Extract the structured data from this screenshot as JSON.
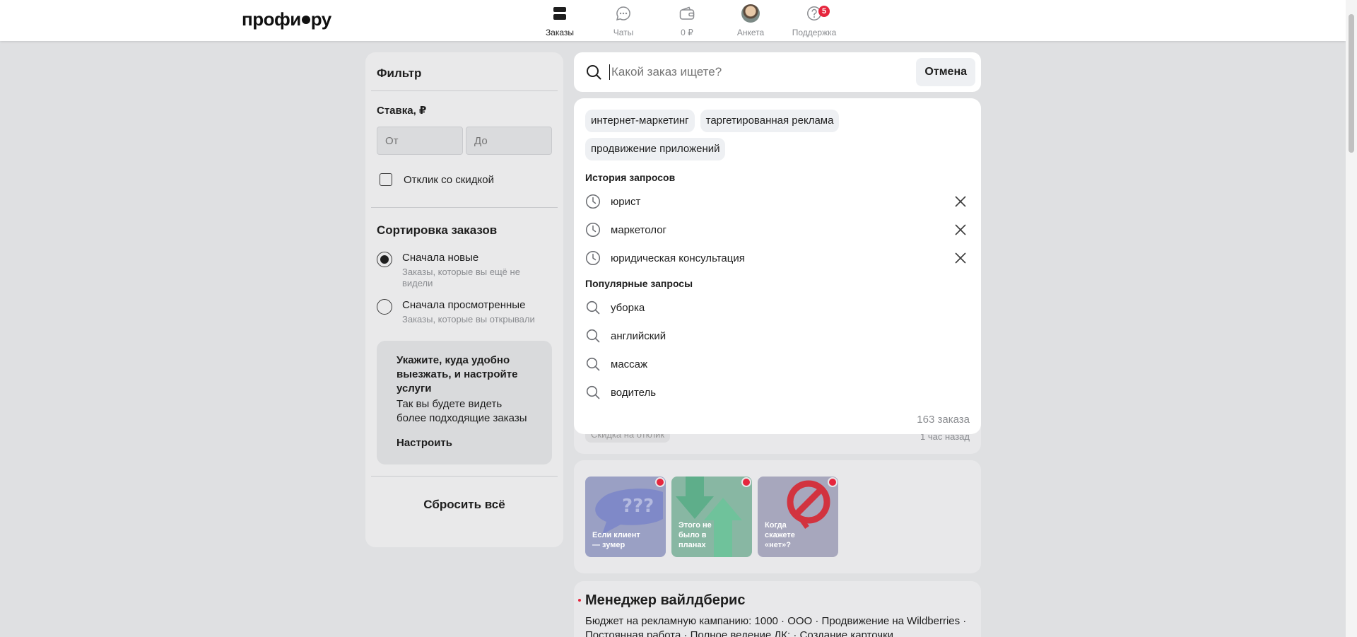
{
  "header": {
    "logo": "профи",
    "logo_suffix": "ру",
    "nav": [
      {
        "label": "Заказы",
        "icon": "orders-icon",
        "active": true
      },
      {
        "label": "Чаты",
        "icon": "chat-icon"
      },
      {
        "label": "0 ₽",
        "icon": "wallet-icon"
      },
      {
        "label": "Анкета",
        "icon": "avatar"
      },
      {
        "label": "Поддержка",
        "icon": "help-icon",
        "badge": "5"
      }
    ]
  },
  "filter": {
    "title": "Фильтр",
    "rate_label": "Ставка, ₽",
    "from_placeholder": "От",
    "to_placeholder": "До",
    "discount_label": "Отклик со скидкой",
    "sort_title": "Сортировка заказов",
    "sort_options": [
      {
        "label": "Сначала новые",
        "desc": "Заказы, которые вы ещё не видели",
        "checked": true
      },
      {
        "label": "Сначала просмотренные",
        "desc": "Заказы, которые вы открывали",
        "checked": false
      }
    ],
    "promo": {
      "title": "Укажите, куда удобно выезжать, и настройте услуги",
      "text": "Так вы будете видеть более подходящие заказы",
      "link": "Настроить"
    },
    "reset": "Сбросить всё"
  },
  "search": {
    "placeholder": "Какой заказ ищете?",
    "cancel": "Отмена",
    "tags": [
      "интернет-маркетинг",
      "таргетированная реклама",
      "продвижение приложений"
    ],
    "history_title": "История запросов",
    "history": [
      "юрист",
      "маркетолог",
      "юридическая консультация"
    ],
    "popular_title": "Популярные запросы",
    "popular": [
      "уборка",
      "английский",
      "массаж",
      "водитель"
    ],
    "count": "163 заказа"
  },
  "feed": {
    "peek_chip": "Скидка на отклик",
    "peek_time": "1 час назад",
    "stories": [
      {
        "text": "Если клиент — зумер"
      },
      {
        "text": "Этого не было в планах"
      },
      {
        "text": "Когда скажете «нет»?"
      }
    ],
    "job_title": "Менеджер вайлдберис",
    "job_desc": "Бюджет на рекламную кампанию: 1000 · ООО · Продвижение на Wildberries · Постоянная работа · Полное ведение ЛК: · Создание карточки"
  },
  "colors": {
    "accent_red": "#e6263d",
    "background": "#dfe0e2",
    "panel": "#e9e9ea"
  }
}
